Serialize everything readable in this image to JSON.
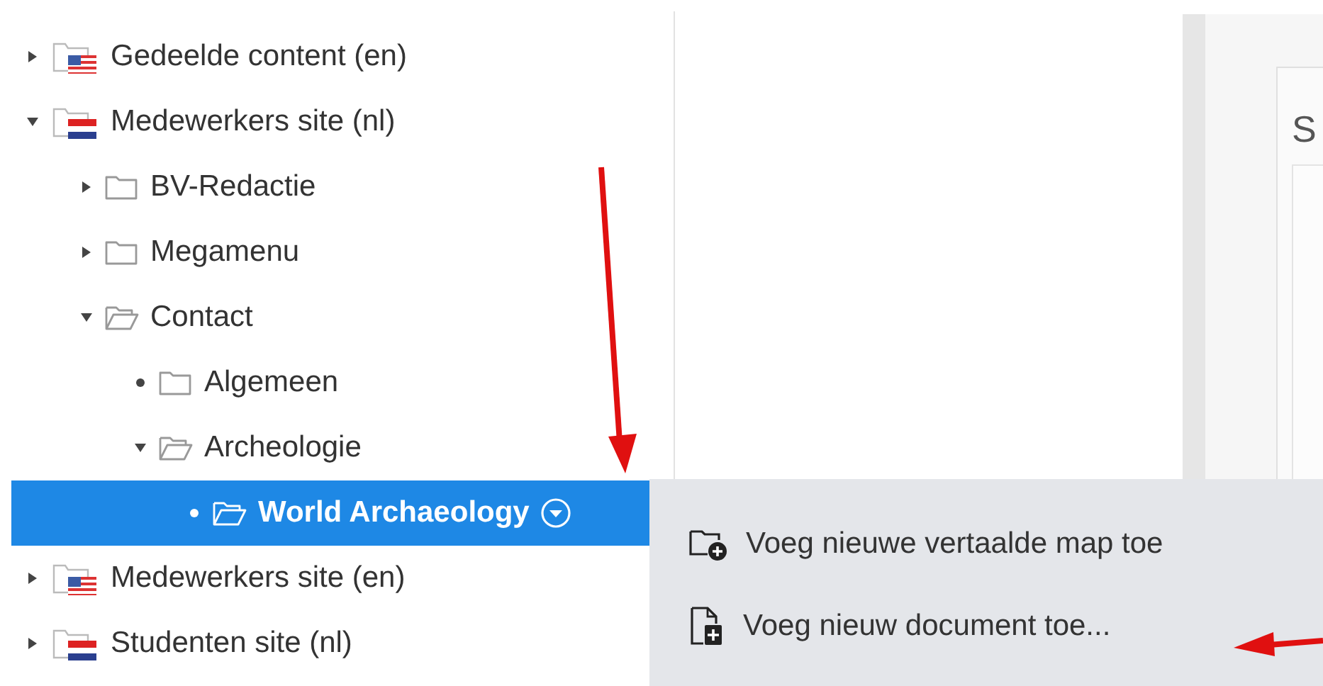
{
  "tree": [
    {
      "label": "Gedeelde content (en)",
      "kind": "site_en",
      "expanded": false,
      "selected": false
    },
    {
      "label": "Medewerkers site (nl)",
      "kind": "site_nl",
      "expanded": true,
      "selected": false,
      "children": [
        {
          "label": "BV-Redactie",
          "kind": "folder",
          "expanded": false,
          "selected": false
        },
        {
          "label": "Megamenu",
          "kind": "folder",
          "expanded": false,
          "selected": false
        },
        {
          "label": "Contact",
          "kind": "folder",
          "expanded": true,
          "selected": false,
          "children": [
            {
              "label": "Algemeen",
              "kind": "leaf_folder",
              "selected": false
            },
            {
              "label": "Archeologie",
              "kind": "folder",
              "expanded": true,
              "selected": false,
              "children": [
                {
                  "label": "World Archaeology",
                  "kind": "leaf_folder",
                  "selected": true
                }
              ]
            }
          ]
        }
      ]
    },
    {
      "label": "Medewerkers site (en)",
      "kind": "site_en",
      "expanded": false,
      "selected": false
    },
    {
      "label": "Studenten site (nl)",
      "kind": "site_nl",
      "expanded": false,
      "selected": false
    }
  ],
  "panel_heading": "S",
  "context_menu": [
    {
      "label": "Voeg nieuwe vertaalde map toe",
      "kind": "folder_plus"
    },
    {
      "label": "Voeg nieuw document toe...",
      "kind": "document_plus"
    }
  ]
}
